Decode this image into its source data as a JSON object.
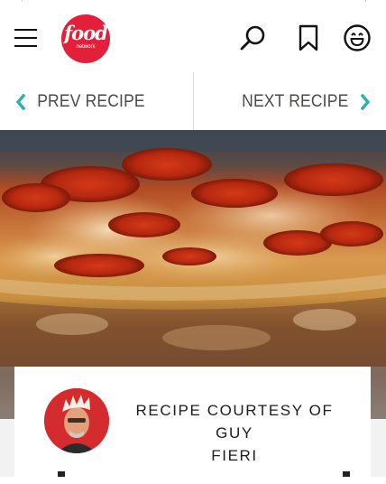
{
  "header": {
    "logo_text": "food",
    "logo_subtext": "network",
    "menu_icon": "hamburger-menu-icon",
    "search_icon": "search-icon",
    "bookmark_icon": "bookmark-icon",
    "profile_icon": "smiley-profile-icon"
  },
  "nav": {
    "prev_label": "PREV RECIPE",
    "next_label": "NEXT RECIPE",
    "accent": "#2ab3a6"
  },
  "hero": {
    "image": "pepperoni-pizza-casserole-photo"
  },
  "credit": {
    "line1": "RECIPE COURTESY OF GUY",
    "line2": "FIERI",
    "avatar": "chef-portrait"
  },
  "colors": {
    "brand_red": "#e41f3a",
    "text": "#474b4f"
  }
}
